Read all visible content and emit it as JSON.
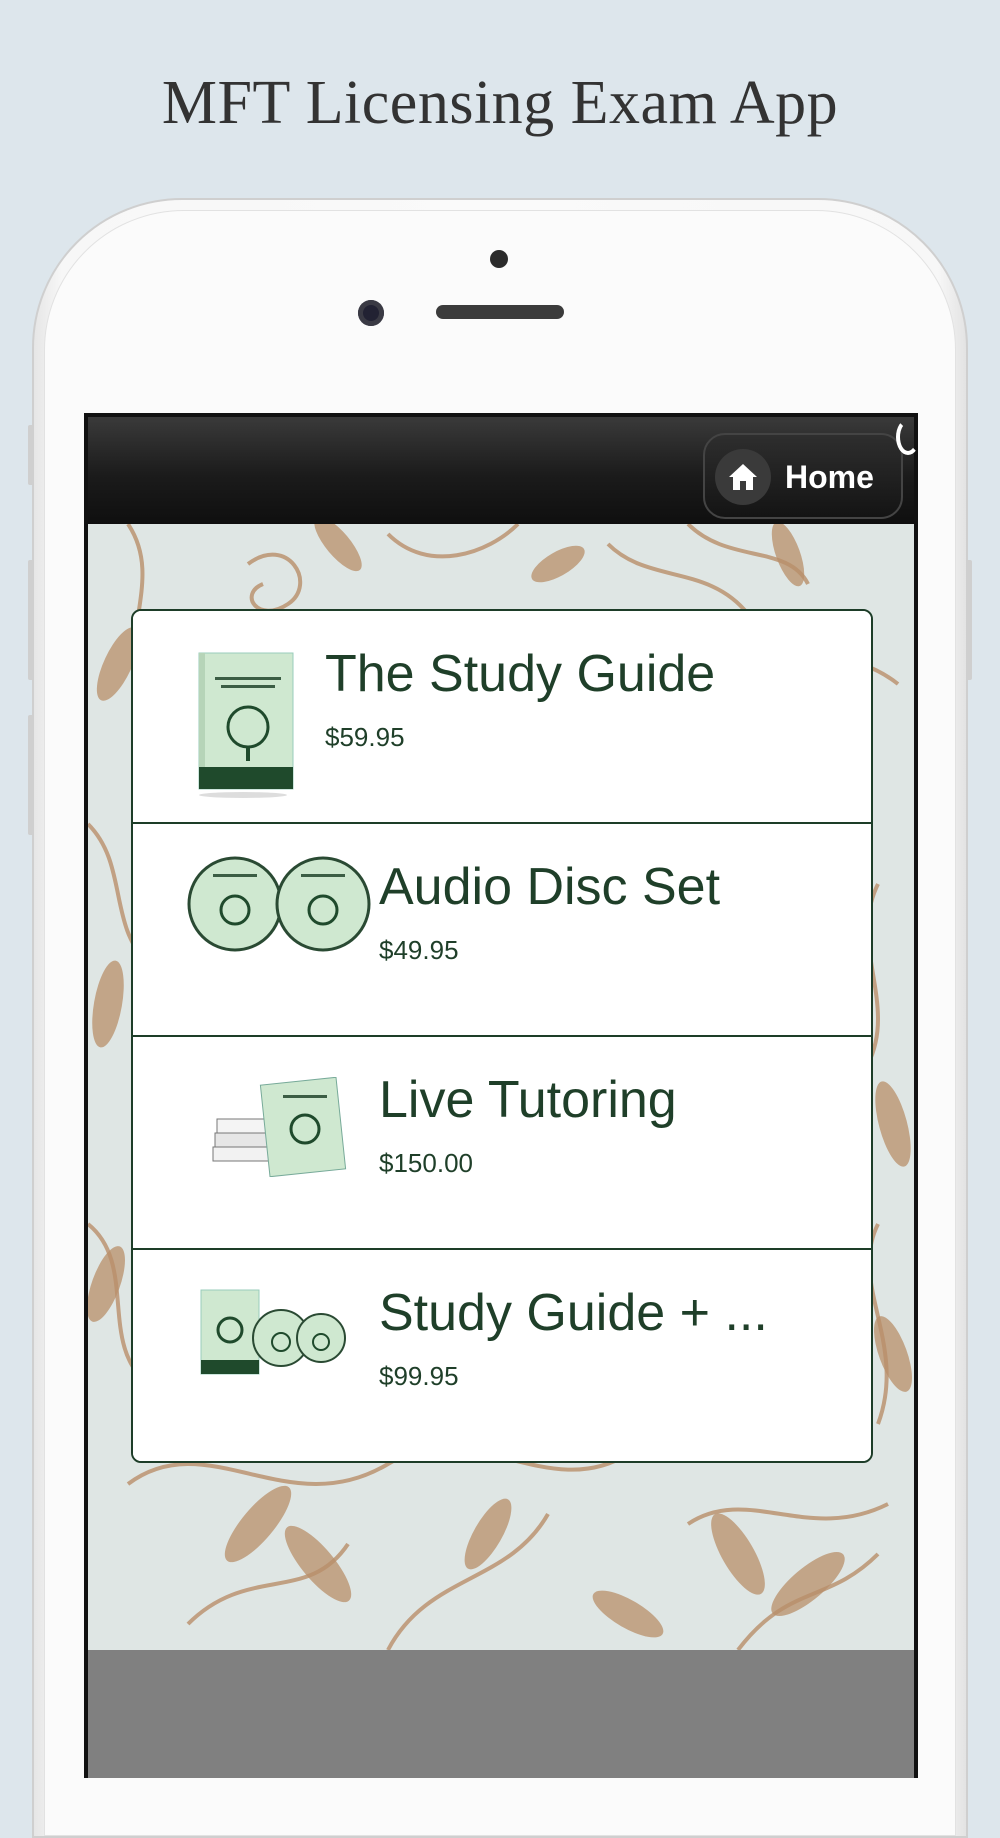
{
  "headline": "MFT Licensing Exam App",
  "navbar": {
    "home_label": "Home"
  },
  "products": [
    {
      "title": "The Study Guide",
      "price": "$59.95",
      "thumb": "book-cover-icon"
    },
    {
      "title": "Audio Disc Set",
      "price": "$49.95",
      "thumb": "audio-discs-icon"
    },
    {
      "title": "Live Tutoring",
      "price": "$150.00",
      "thumb": "book-stack-icon"
    },
    {
      "title": "Study Guide + ...",
      "price": "$99.95",
      "thumb": "bundle-icon"
    }
  ],
  "colors": {
    "accent": "#1f3f29",
    "page_bg": "#dde6ec",
    "footer": "#808080"
  }
}
